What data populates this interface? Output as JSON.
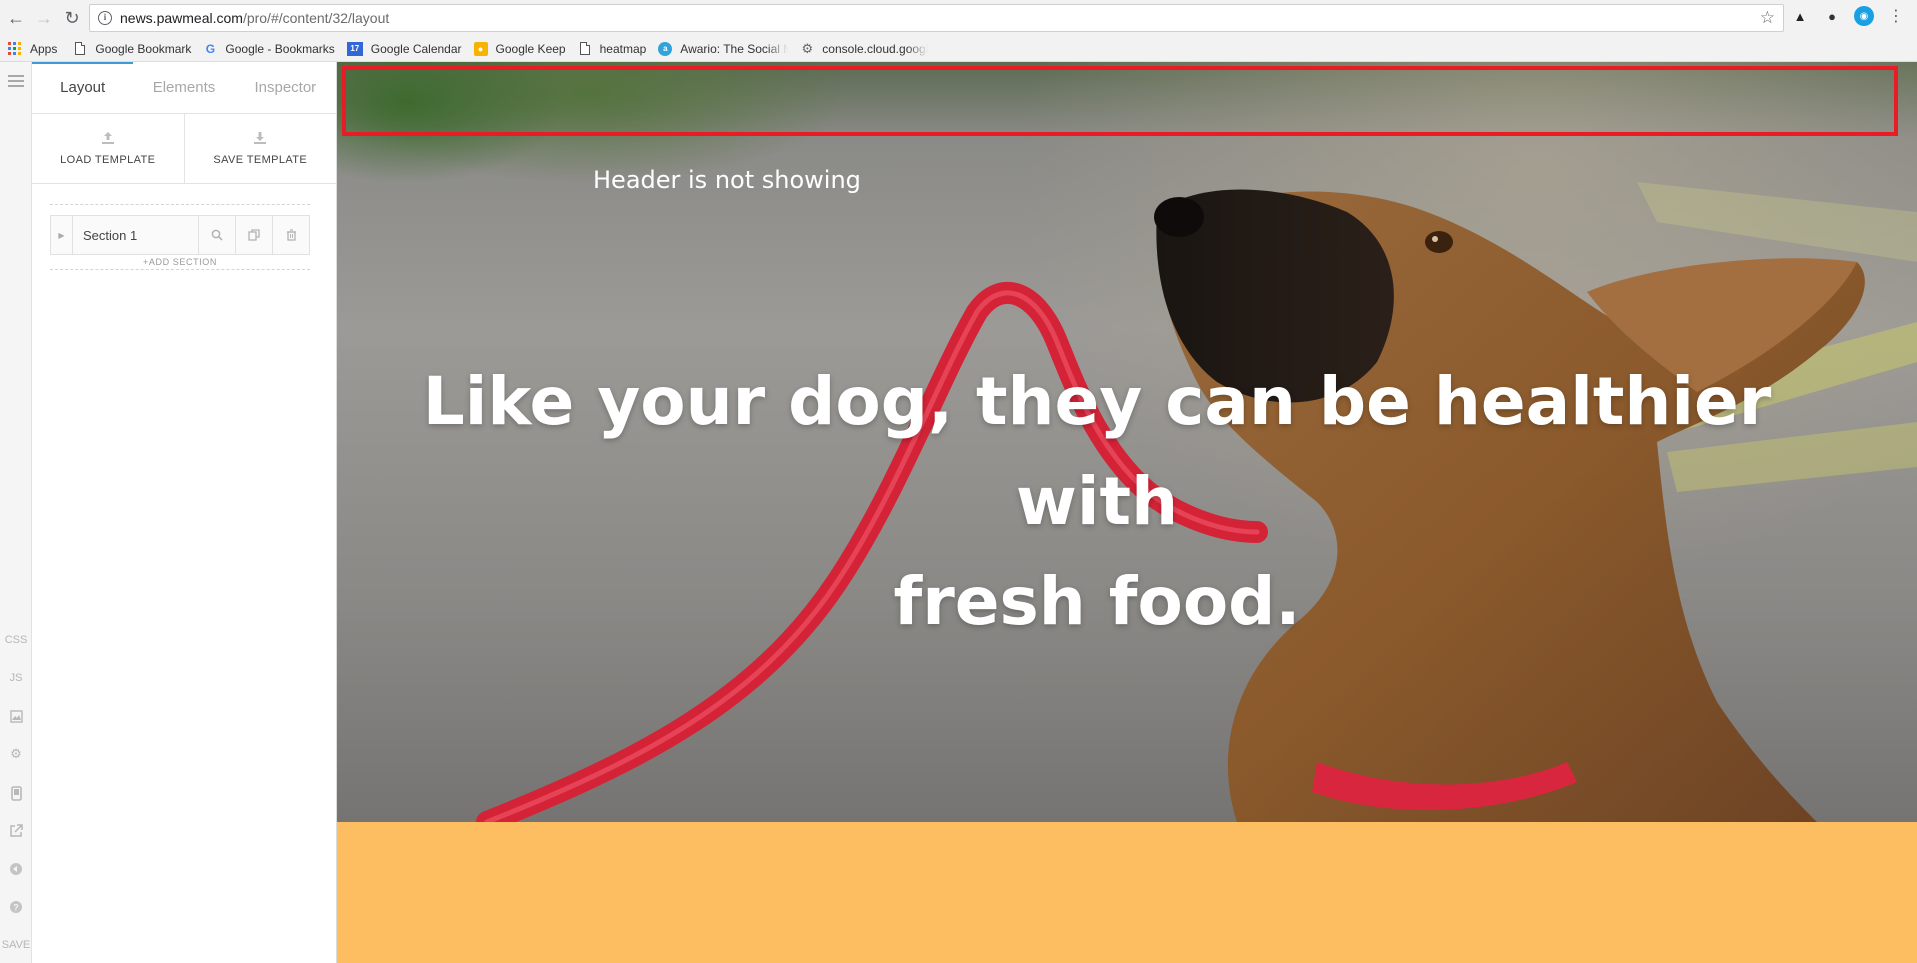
{
  "browser": {
    "url_host": "news.pawmeal.com",
    "url_path": "/pro/#/content/32/layout",
    "bookmarks": [
      {
        "label": "Apps",
        "icon": "apps-grid-icon"
      },
      {
        "label": "Google Bookmark",
        "icon": "page-icon"
      },
      {
        "label": "Google - Bookmarks",
        "icon": "google-g-icon"
      },
      {
        "label": "Google Calendar",
        "icon": "calendar-icon"
      },
      {
        "label": "Google Keep",
        "icon": "keep-bulb-icon"
      },
      {
        "label": "heatmap",
        "icon": "page-icon"
      },
      {
        "label": "Awario: The Social M",
        "icon": "awario-icon"
      },
      {
        "label": "console.cloud.googl",
        "icon": "gear-icon"
      }
    ],
    "calendar_badge": "17"
  },
  "rail": {
    "css": "CSS",
    "js": "JS",
    "save": "SAVE"
  },
  "panel": {
    "tabs": [
      "Layout",
      "Elements",
      "Inspector"
    ],
    "active_tab": "Layout",
    "load_template": "LOAD TEMPLATE",
    "save_template": "SAVE TEMPLATE",
    "section_name": "Section 1",
    "add_section": "+ADD SECTION"
  },
  "canvas": {
    "header_note": "Header is not showing",
    "headline_line1": "Like your dog, they can be healthier with",
    "headline_line2": "fresh food.",
    "outline_color": "#e81c24",
    "band_color": "#fdbd61"
  }
}
